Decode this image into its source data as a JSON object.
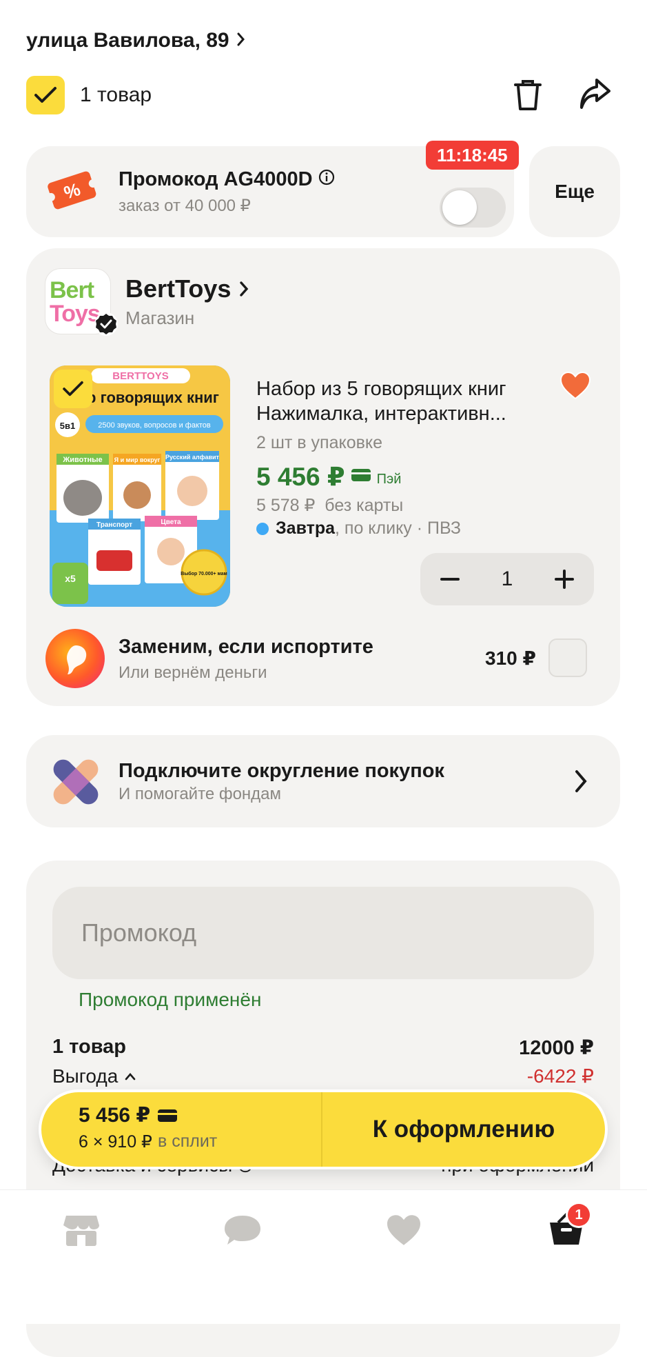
{
  "header": {
    "address": "улица Вавилова, 89",
    "select_all_label": "1 товар"
  },
  "promo_banner": {
    "title": "Промокод AG4000D",
    "subtitle": "заказ от 40 000 ₽",
    "timer": "11:18:45",
    "toggle_on": false,
    "more_label": "Еще"
  },
  "store": {
    "name": "BertToys",
    "type": "Магазин",
    "logo_text_1": "Bert",
    "logo_text_2": "Toys"
  },
  "product": {
    "title_line1": "Набор из 5 говорящих книг",
    "title_line2": "Нажималка, интерактивн...",
    "pack": "2 шт в упаковке",
    "price": "5 456 ₽",
    "pay_label": "Пэй",
    "price_no_card": "5 578 ₽  без карты",
    "delivery_bold": "Завтра",
    "delivery_rest": ", по клику · ПВЗ",
    "quantity": "1",
    "image_brand": "BERTTOYS",
    "image_title": "р говорящих книг",
    "image_badge": "5в1",
    "image_subtitle": "2500 звуков, вопросов и фактов",
    "image_books": [
      "Животные",
      "Я и мир вокруг",
      "Русский алфавит",
      "Транспорт",
      "Цвета"
    ],
    "image_x5": "x5",
    "image_seal": "Выбор 70.000+ мам"
  },
  "protection": {
    "title": "Заменим, если испортите",
    "subtitle": "Или вернём деньги",
    "price": "310 ₽"
  },
  "rounding": {
    "title": "Подключите округление покупок",
    "subtitle": "И помогайте фондам"
  },
  "summary": {
    "promo_placeholder": "Промокод",
    "promo_applied": "Промокод применён",
    "items_label": "1 товар",
    "items_value": "12000 ₽",
    "benefit_label": "Выгода",
    "benefit_value": "-6422 ₽",
    "delivery_label": "Доставка и сервисы",
    "delivery_value": "при оформлении"
  },
  "checkout": {
    "price": "5 456 ₽",
    "split": "6 × 910 ₽",
    "split_suffix": "в сплит",
    "button": "К оформлению"
  },
  "tabbar": {
    "cart_badge": "1"
  },
  "colors": {
    "accent_yellow": "#fbdc3c",
    "price_green": "#2e7d32",
    "timer_red": "#f23d36",
    "benefit_red": "#d0302f"
  }
}
